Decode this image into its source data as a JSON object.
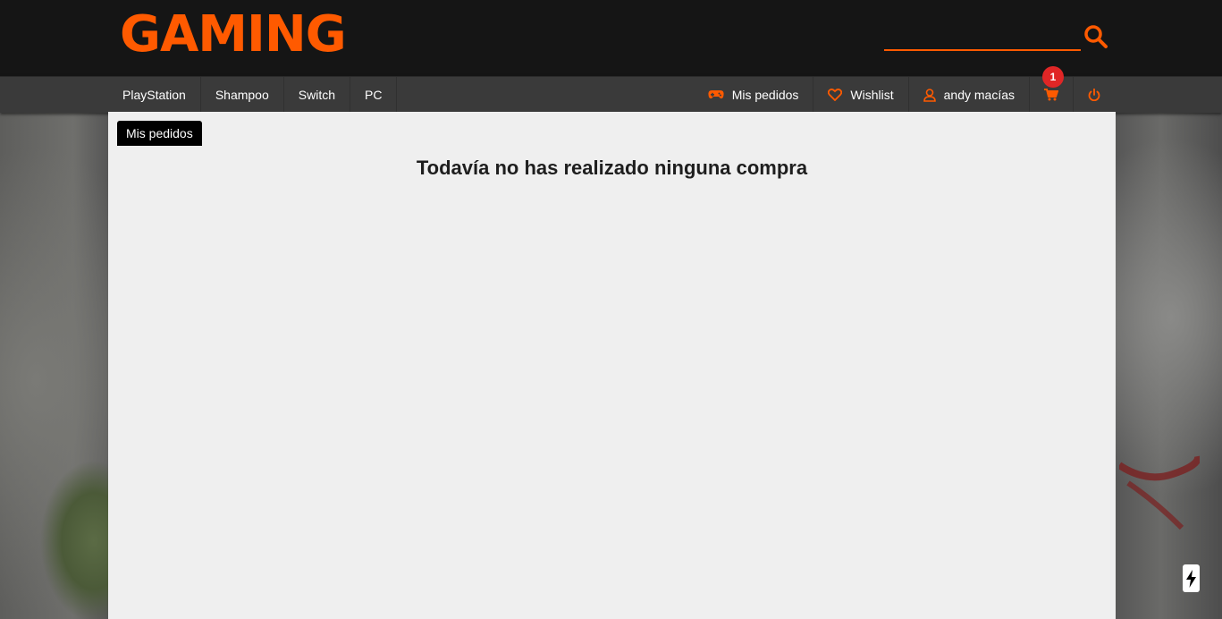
{
  "brand": {
    "logo_text": "GAMING",
    "accent_color": "#ff5a00"
  },
  "search": {
    "placeholder": "",
    "value": "",
    "icon": "search-icon"
  },
  "nav": {
    "categories": [
      {
        "label": "PlayStation"
      },
      {
        "label": "Shampoo"
      },
      {
        "label": "Switch"
      },
      {
        "label": "PC"
      }
    ],
    "account": {
      "orders": {
        "label": "Mis pedidos",
        "icon": "gamepad-icon"
      },
      "wishlist": {
        "label": "Wishlist",
        "icon": "heart-icon"
      },
      "user": {
        "label": "andy macías",
        "icon": "user-icon"
      },
      "cart": {
        "icon": "cart-icon",
        "count": "1",
        "badge_color": "#e02626"
      },
      "logout": {
        "icon": "power-icon"
      }
    }
  },
  "main": {
    "tab_label": "Mis pedidos",
    "empty_message": "Todavía no has realizado ninguna compra"
  },
  "floating": {
    "icon": "lightning-icon"
  }
}
